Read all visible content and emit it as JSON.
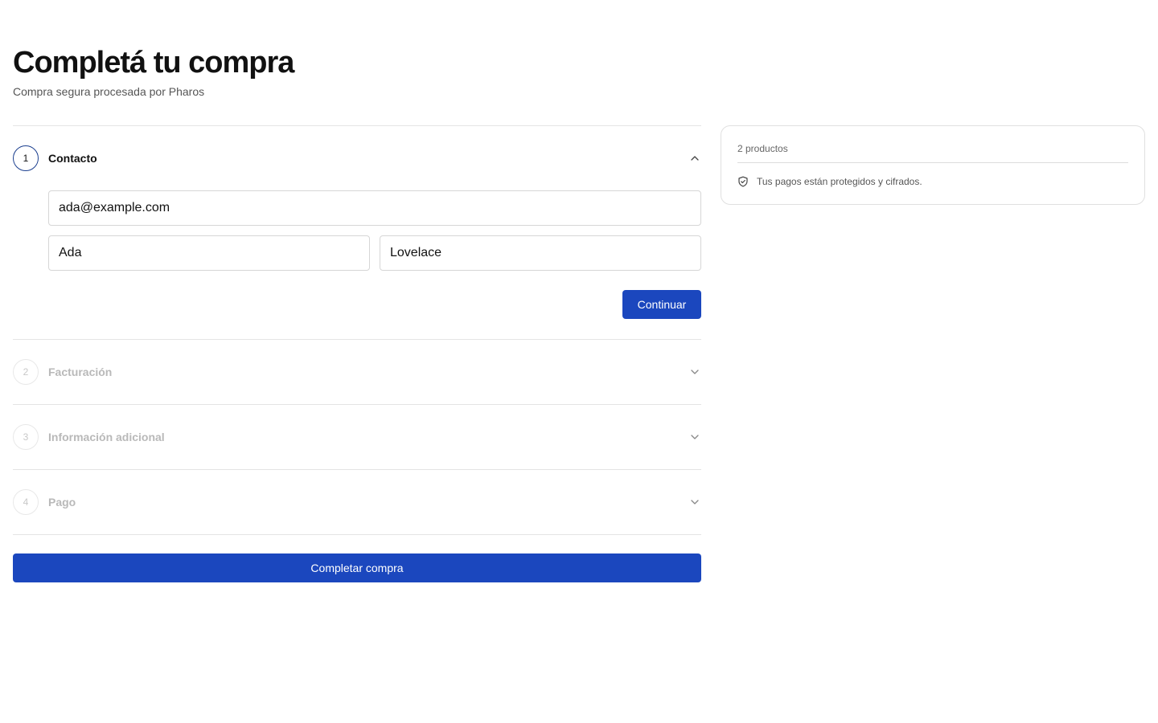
{
  "header": {
    "title": "Completá tu compra",
    "subtitle": "Compra segura procesada por Pharos"
  },
  "steps": [
    {
      "number": "1",
      "title": "Contacto",
      "state": "expanded"
    },
    {
      "number": "2",
      "title": "Facturación",
      "state": "collapsed"
    },
    {
      "number": "3",
      "title": "Información adicional",
      "state": "collapsed"
    },
    {
      "number": "4",
      "title": "Pago",
      "state": "collapsed"
    }
  ],
  "contact": {
    "email_value": "ada@example.com",
    "first_name_value": "Ada",
    "last_name_value": "Lovelace",
    "continue_label": "Continuar"
  },
  "complete_label": "Completar compra",
  "summary": {
    "count": "2 productos",
    "secure_note": "Tus pagos están protegidos y cifrados."
  },
  "colors": {
    "primary": "#1b47be",
    "active_ring": "#1b3f8f",
    "muted": "#b9b9b9"
  },
  "icons": {
    "expanded": "chevron-up-icon",
    "collapsed": "chevron-down-icon",
    "secure": "shield-check-icon"
  }
}
